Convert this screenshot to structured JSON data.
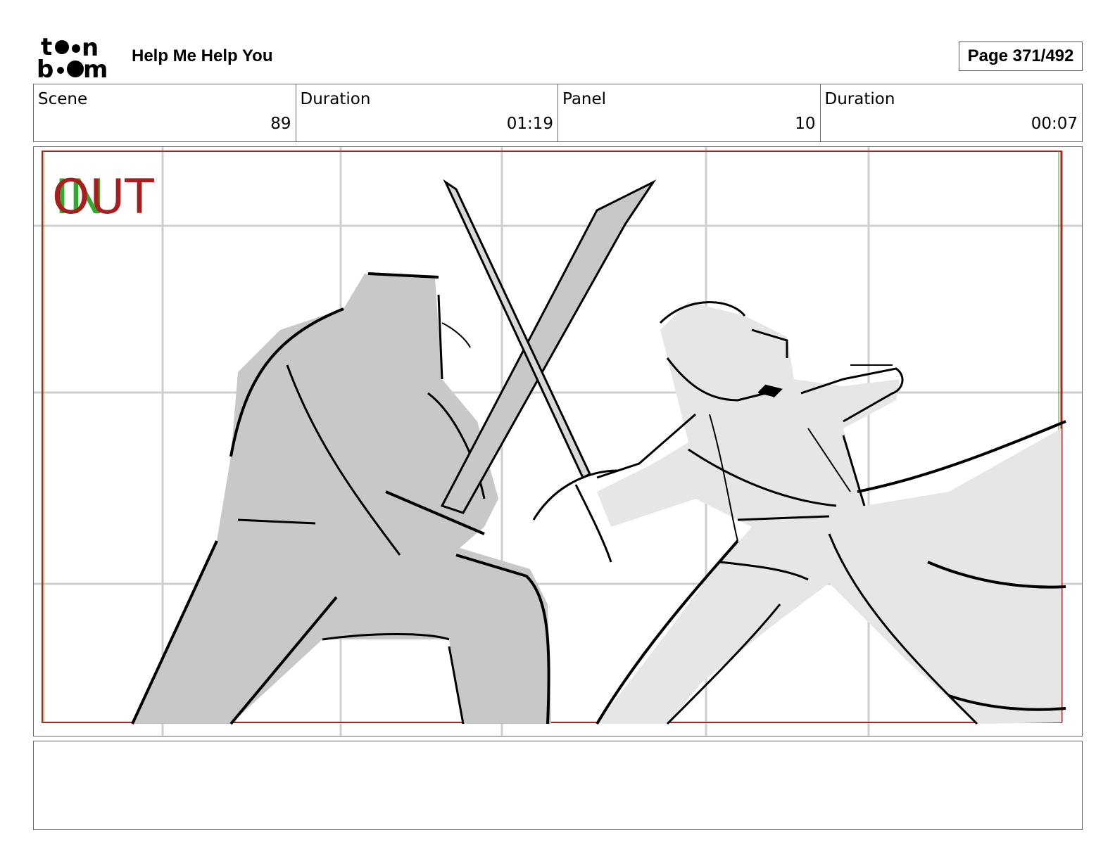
{
  "header": {
    "logo_top": "t●●n",
    "logo_bottom": "b●●m",
    "project_title": "Help Me Help You",
    "page_label": "Page 371/492"
  },
  "info": {
    "scene_label": "Scene",
    "scene_value": "89",
    "scene_duration_label": "Duration",
    "scene_duration_value": "01:19",
    "panel_label": "Panel",
    "panel_value": "10",
    "panel_duration_label": "Duration",
    "panel_duration_value": "00:07"
  },
  "panel": {
    "marker_in": "IN",
    "marker_out": "OUT",
    "in_color": "#2eaa2e",
    "out_color": "#a81e1e",
    "safe_frame_color": "#b02020",
    "grid_color": "#cfcfcf"
  },
  "notes": {
    "text": ""
  }
}
